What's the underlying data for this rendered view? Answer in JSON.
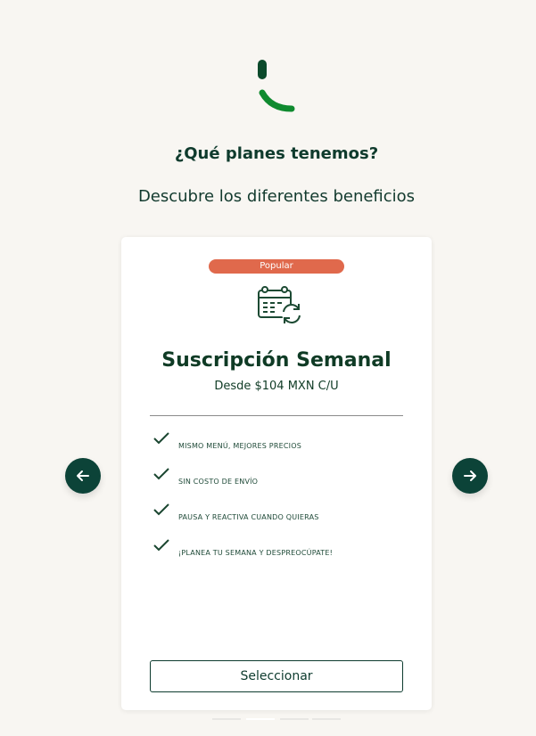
{
  "header": {
    "logo_icon": "brand-smile-logo",
    "title": "¿Qué planes tenemos?",
    "subtitle": "Descubre los diferentes beneficios"
  },
  "carousel": {
    "prev_icon": "arrow-left-icon",
    "next_icon": "arrow-right-icon",
    "active_index": 1,
    "dot_count": 4
  },
  "plan": {
    "badge": "Popular",
    "icon": "calendar-refresh-icon",
    "name": "Suscripción Semanal",
    "price": "Desde $104 MXN C/U",
    "benefits": [
      {
        "icon": "check-icon",
        "text": "MISMO MENÚ, MEJORES PRECIOS"
      },
      {
        "icon": "check-icon",
        "text": "SIN COSTO DE ENVÍO"
      },
      {
        "icon": "check-icon",
        "text": "PAUSA Y REACTIVA CUANDO QUIERAS"
      },
      {
        "icon": "check-icon",
        "text": "¡PLANEA TU SEMANA Y DESPREOCÚPATE!"
      }
    ],
    "select_label": "Seleccionar"
  },
  "colors": {
    "background": "#f8f6f2",
    "primary": "#0c4338",
    "badge": "#e0694c",
    "logo_dark": "#0b4a2b",
    "logo_green": "#0f8a2f"
  }
}
